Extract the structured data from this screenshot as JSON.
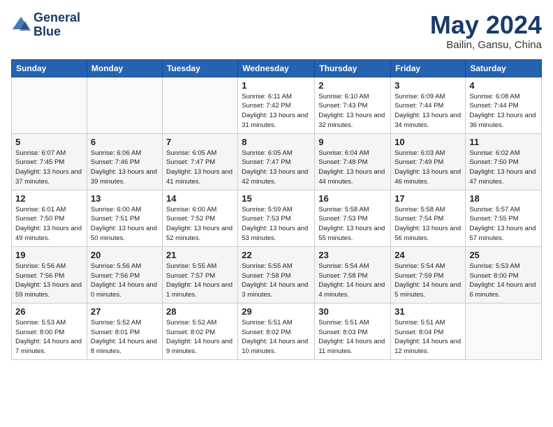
{
  "header": {
    "logo_line1": "General",
    "logo_line2": "Blue",
    "month_title": "May 2024",
    "location": "Bailin, Gansu, China"
  },
  "weekdays": [
    "Sunday",
    "Monday",
    "Tuesday",
    "Wednesday",
    "Thursday",
    "Friday",
    "Saturday"
  ],
  "weeks": [
    [
      {
        "day": "",
        "info": ""
      },
      {
        "day": "",
        "info": ""
      },
      {
        "day": "",
        "info": ""
      },
      {
        "day": "1",
        "info": "Sunrise: 6:11 AM\nSunset: 7:42 PM\nDaylight: 13 hours\nand 31 minutes."
      },
      {
        "day": "2",
        "info": "Sunrise: 6:10 AM\nSunset: 7:43 PM\nDaylight: 13 hours\nand 32 minutes."
      },
      {
        "day": "3",
        "info": "Sunrise: 6:09 AM\nSunset: 7:44 PM\nDaylight: 13 hours\nand 34 minutes."
      },
      {
        "day": "4",
        "info": "Sunrise: 6:08 AM\nSunset: 7:44 PM\nDaylight: 13 hours\nand 36 minutes."
      }
    ],
    [
      {
        "day": "5",
        "info": "Sunrise: 6:07 AM\nSunset: 7:45 PM\nDaylight: 13 hours\nand 37 minutes."
      },
      {
        "day": "6",
        "info": "Sunrise: 6:06 AM\nSunset: 7:46 PM\nDaylight: 13 hours\nand 39 minutes."
      },
      {
        "day": "7",
        "info": "Sunrise: 6:05 AM\nSunset: 7:47 PM\nDaylight: 13 hours\nand 41 minutes."
      },
      {
        "day": "8",
        "info": "Sunrise: 6:05 AM\nSunset: 7:47 PM\nDaylight: 13 hours\nand 42 minutes."
      },
      {
        "day": "9",
        "info": "Sunrise: 6:04 AM\nSunset: 7:48 PM\nDaylight: 13 hours\nand 44 minutes."
      },
      {
        "day": "10",
        "info": "Sunrise: 6:03 AM\nSunset: 7:49 PM\nDaylight: 13 hours\nand 46 minutes."
      },
      {
        "day": "11",
        "info": "Sunrise: 6:02 AM\nSunset: 7:50 PM\nDaylight: 13 hours\nand 47 minutes."
      }
    ],
    [
      {
        "day": "12",
        "info": "Sunrise: 6:01 AM\nSunset: 7:50 PM\nDaylight: 13 hours\nand 49 minutes."
      },
      {
        "day": "13",
        "info": "Sunrise: 6:00 AM\nSunset: 7:51 PM\nDaylight: 13 hours\nand 50 minutes."
      },
      {
        "day": "14",
        "info": "Sunrise: 6:00 AM\nSunset: 7:52 PM\nDaylight: 13 hours\nand 52 minutes."
      },
      {
        "day": "15",
        "info": "Sunrise: 5:59 AM\nSunset: 7:53 PM\nDaylight: 13 hours\nand 53 minutes."
      },
      {
        "day": "16",
        "info": "Sunrise: 5:58 AM\nSunset: 7:53 PM\nDaylight: 13 hours\nand 55 minutes."
      },
      {
        "day": "17",
        "info": "Sunrise: 5:58 AM\nSunset: 7:54 PM\nDaylight: 13 hours\nand 56 minutes."
      },
      {
        "day": "18",
        "info": "Sunrise: 5:57 AM\nSunset: 7:55 PM\nDaylight: 13 hours\nand 57 minutes."
      }
    ],
    [
      {
        "day": "19",
        "info": "Sunrise: 5:56 AM\nSunset: 7:56 PM\nDaylight: 13 hours\nand 59 minutes."
      },
      {
        "day": "20",
        "info": "Sunrise: 5:56 AM\nSunset: 7:56 PM\nDaylight: 14 hours\nand 0 minutes."
      },
      {
        "day": "21",
        "info": "Sunrise: 5:55 AM\nSunset: 7:57 PM\nDaylight: 14 hours\nand 1 minutes."
      },
      {
        "day": "22",
        "info": "Sunrise: 5:55 AM\nSunset: 7:58 PM\nDaylight: 14 hours\nand 3 minutes."
      },
      {
        "day": "23",
        "info": "Sunrise: 5:54 AM\nSunset: 7:58 PM\nDaylight: 14 hours\nand 4 minutes."
      },
      {
        "day": "24",
        "info": "Sunrise: 5:54 AM\nSunset: 7:59 PM\nDaylight: 14 hours\nand 5 minutes."
      },
      {
        "day": "25",
        "info": "Sunrise: 5:53 AM\nSunset: 8:00 PM\nDaylight: 14 hours\nand 6 minutes."
      }
    ],
    [
      {
        "day": "26",
        "info": "Sunrise: 5:53 AM\nSunset: 8:00 PM\nDaylight: 14 hours\nand 7 minutes."
      },
      {
        "day": "27",
        "info": "Sunrise: 5:52 AM\nSunset: 8:01 PM\nDaylight: 14 hours\nand 8 minutes."
      },
      {
        "day": "28",
        "info": "Sunrise: 5:52 AM\nSunset: 8:02 PM\nDaylight: 14 hours\nand 9 minutes."
      },
      {
        "day": "29",
        "info": "Sunrise: 5:51 AM\nSunset: 8:02 PM\nDaylight: 14 hours\nand 10 minutes."
      },
      {
        "day": "30",
        "info": "Sunrise: 5:51 AM\nSunset: 8:03 PM\nDaylight: 14 hours\nand 11 minutes."
      },
      {
        "day": "31",
        "info": "Sunrise: 5:51 AM\nSunset: 8:04 PM\nDaylight: 14 hours\nand 12 minutes."
      },
      {
        "day": "",
        "info": ""
      }
    ]
  ]
}
